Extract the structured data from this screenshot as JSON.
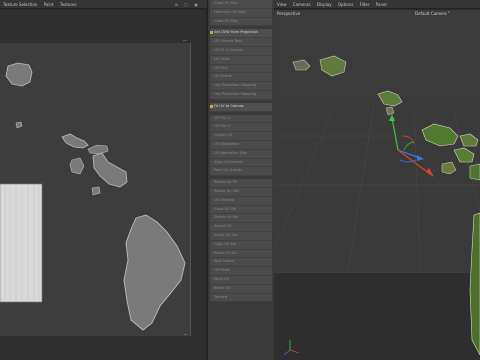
{
  "left_menubar": {
    "items": [
      "Texture Selection",
      "Paint",
      "Textures"
    ]
  },
  "middle_panel": {
    "items": [
      {
        "label": "Color UV Poly",
        "state": "dim"
      },
      {
        "label": "Hierarchy UV Poly",
        "state": "dim"
      },
      {
        "label": "Color UV Poly",
        "state": "dim"
      },
      {
        "label": "Set UVW from Projection",
        "state": "hl"
      },
      {
        "label": "UV Canvas Rect",
        "state": "dim"
      },
      {
        "label": "UV Fit in Canvas",
        "state": "dim"
      },
      {
        "label": "UV Grow",
        "state": "dim"
      },
      {
        "label": "UV Peel",
        "state": "dim"
      },
      {
        "label": "UV Shrink",
        "state": "dim"
      },
      {
        "label": "Use Projection Mapping",
        "state": "dim"
      },
      {
        "label": "Use Projection Mapping",
        "state": "dim"
      },
      {
        "label": "Fit UV to Canvas",
        "state": "hl"
      },
      {
        "label": "UV Flip U",
        "state": "dim"
      },
      {
        "label": "UV Flip V",
        "state": "dim"
      },
      {
        "label": "Center UV",
        "state": "dim"
      },
      {
        "label": "UV Straighten",
        "state": "dim"
      },
      {
        "label": "UV Normalize Size",
        "state": "dim"
      },
      {
        "label": "Align UV Islands",
        "state": "dim"
      },
      {
        "label": "Pack UV Islands",
        "state": "dim"
      },
      {
        "label": "Rotate by 90",
        "state": "dim"
      },
      {
        "label": "Rotate by 180",
        "state": "dim"
      },
      {
        "label": "UV Unwrap",
        "state": "dim"
      },
      {
        "label": "Grow UV Sel",
        "state": "dim"
      },
      {
        "label": "Shrink UV Sel",
        "state": "dim"
      },
      {
        "label": "Select UV",
        "state": "dim"
      },
      {
        "label": "Invert UV Sel",
        "state": "dim"
      },
      {
        "label": "Copy UV Sel",
        "state": "dim"
      },
      {
        "label": "Paste UV Sel",
        "state": "dim"
      },
      {
        "label": "Split Island",
        "state": "dim"
      },
      {
        "label": "UV Relax",
        "state": "dim"
      },
      {
        "label": "Weld UV",
        "state": "dim"
      },
      {
        "label": "Brush UV",
        "state": "dim"
      },
      {
        "label": "Terrace",
        "state": "dim"
      }
    ]
  },
  "right_menubar": {
    "items": [
      "View",
      "Cameras",
      "Display",
      "Options",
      "Filter",
      "Panel"
    ]
  },
  "viewport": {
    "projection_label": "Perspective",
    "camera_label": "Default Camera °"
  },
  "colors": {
    "island_fill": "#7a7a7a",
    "island_stroke": "#bdbdbd",
    "axis_x": "#e0412f",
    "axis_y": "#3ec24a",
    "axis_z": "#2f7de0"
  }
}
